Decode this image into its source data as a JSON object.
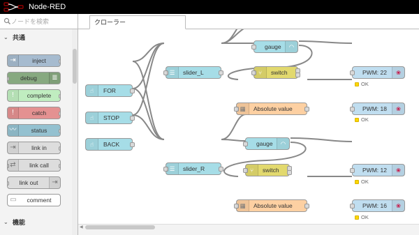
{
  "app": {
    "title": "Node-RED"
  },
  "palette": {
    "search_placeholder": "ノードを検索",
    "categories": [
      {
        "label": "共通"
      },
      {
        "label": "機能"
      }
    ],
    "nodes": [
      {
        "label": "inject",
        "color": "#a6bbcf",
        "icon": "arrow-in-icon",
        "side": "left"
      },
      {
        "label": "debug",
        "color": "#87a980",
        "icon": "debug-list-icon",
        "side": "right"
      },
      {
        "label": "complete",
        "color": "#c0edc0",
        "icon": "exclamation-icon",
        "side": "left"
      },
      {
        "label": "catch",
        "color": "#e49191",
        "icon": "exclamation-icon",
        "side": "left"
      },
      {
        "label": "status",
        "color": "#94c1d0",
        "icon": "pulse-icon",
        "side": "left"
      },
      {
        "label": "link in",
        "color": "#dddddd",
        "icon": "link-icon",
        "side": "left"
      },
      {
        "label": "link call",
        "color": "#dddddd",
        "icon": "link-icon",
        "side": "left"
      },
      {
        "label": "link out",
        "color": "#dddddd",
        "icon": "link-icon",
        "side": "right"
      },
      {
        "label": "comment",
        "color": "#ffffff",
        "icon": "comment-icon",
        "side": "left"
      }
    ]
  },
  "workspace": {
    "tab_label": "クローラー"
  },
  "flow": {
    "colors": {
      "button": "#a6dde7",
      "slider": "#a6dde7",
      "gauge": "#a6dde7",
      "switch": "#e2d96e",
      "function": "#fdd0a2",
      "pwm": "#c0def0",
      "wire": "#888888",
      "status": "#ffd700"
    },
    "nodes": {
      "for": {
        "label": "FOR",
        "icon": "hand-pointer-icon"
      },
      "stop": {
        "label": "STOP",
        "icon": "hand-pointer-icon"
      },
      "back": {
        "label": "BACK",
        "icon": "hand-pointer-icon"
      },
      "slider_l": {
        "label": "slider_L",
        "icon": "sliders-icon"
      },
      "slider_r": {
        "label": "slider_R",
        "icon": "sliders-icon"
      },
      "gauge_1": {
        "label": "gauge",
        "icon": "gauge-icon"
      },
      "gauge_2": {
        "label": "gauge",
        "icon": "gauge-icon"
      },
      "switch_1": {
        "label": "switch",
        "icon": "switch-icon"
      },
      "switch_2": {
        "label": "switch",
        "icon": "switch-icon"
      },
      "abs_1": {
        "label": "Absolute value",
        "icon": "calculator-icon"
      },
      "abs_2": {
        "label": "Absolute value",
        "icon": "calculator-icon"
      },
      "pwm_22": {
        "label": "PWM: 22",
        "status": "OK",
        "icon": "raspberry-icon"
      },
      "pwm_18": {
        "label": "PWM: 18",
        "status": "OK",
        "icon": "raspberry-icon"
      },
      "pwm_12": {
        "label": "PWM: 12",
        "status": "OK",
        "icon": "raspberry-icon"
      },
      "pwm_16": {
        "label": "PWM: 16",
        "status": "OK",
        "icon": "raspberry-icon"
      }
    }
  }
}
